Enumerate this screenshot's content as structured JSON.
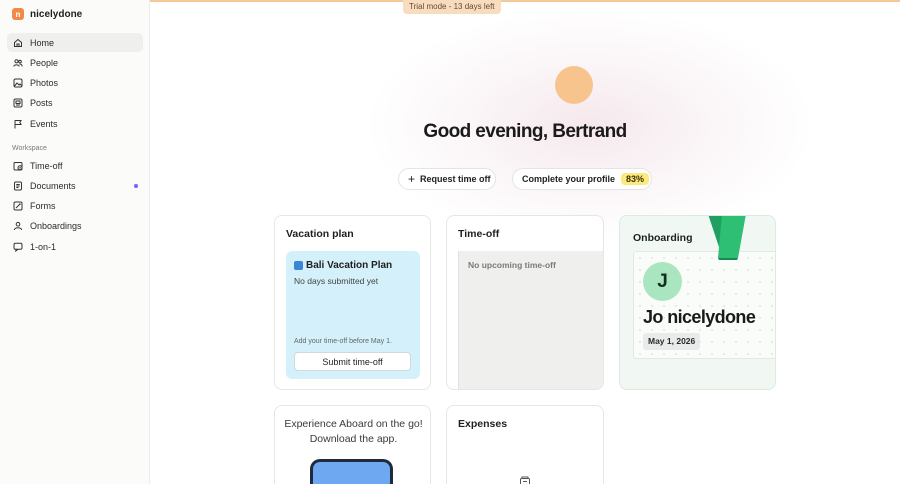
{
  "brand": {
    "name": "nicelydone",
    "logo_letter": "n"
  },
  "trial": {
    "text": "Trial mode - 13 days left"
  },
  "sidebar": {
    "items": [
      {
        "label": "Home",
        "icon": "home-icon",
        "active": true
      },
      {
        "label": "People",
        "icon": "people-icon"
      },
      {
        "label": "Photos",
        "icon": "photos-icon"
      },
      {
        "label": "Posts",
        "icon": "posts-icon"
      },
      {
        "label": "Events",
        "icon": "flag-icon"
      }
    ],
    "workspace_label": "Workspace",
    "workspace_items": [
      {
        "label": "Time-off",
        "icon": "time-off-icon"
      },
      {
        "label": "Documents",
        "icon": "documents-icon",
        "notification": true
      },
      {
        "label": "Forms",
        "icon": "forms-icon"
      },
      {
        "label": "Onboardings",
        "icon": "onboardings-icon"
      },
      {
        "label": "1-on-1",
        "icon": "chat-icon"
      }
    ]
  },
  "main": {
    "greeting": "Good evening, Bertrand",
    "request_time_off": "Request time off",
    "complete_profile": "Complete your profile",
    "profile_percent": "83%"
  },
  "cards": {
    "vacation": {
      "title": "Vacation plan",
      "plan_name": "Bali Vacation Plan",
      "status": "No days submitted yet",
      "hint": "Add your time-off before May 1.",
      "button": "Submit time-off"
    },
    "timeoff": {
      "title": "Time-off",
      "empty": "No upcoming time-off"
    },
    "onboarding": {
      "title": "Onboarding",
      "initial": "J",
      "name": "Jo nicelydone",
      "date": "May 1, 2026"
    },
    "app": {
      "line1": "Experience Aboard on the go!",
      "line2": "Download the app."
    },
    "expenses": {
      "title": "Expenses"
    }
  },
  "colors": {
    "accent_orange": "#f08a4b",
    "avatar_peach": "#f7c48e",
    "percent_yellow": "#fcea7e",
    "vacation_blue": "#d4f1fb",
    "onboarding_green": "#a9e6c0",
    "notification_purple": "#7a5cff"
  }
}
